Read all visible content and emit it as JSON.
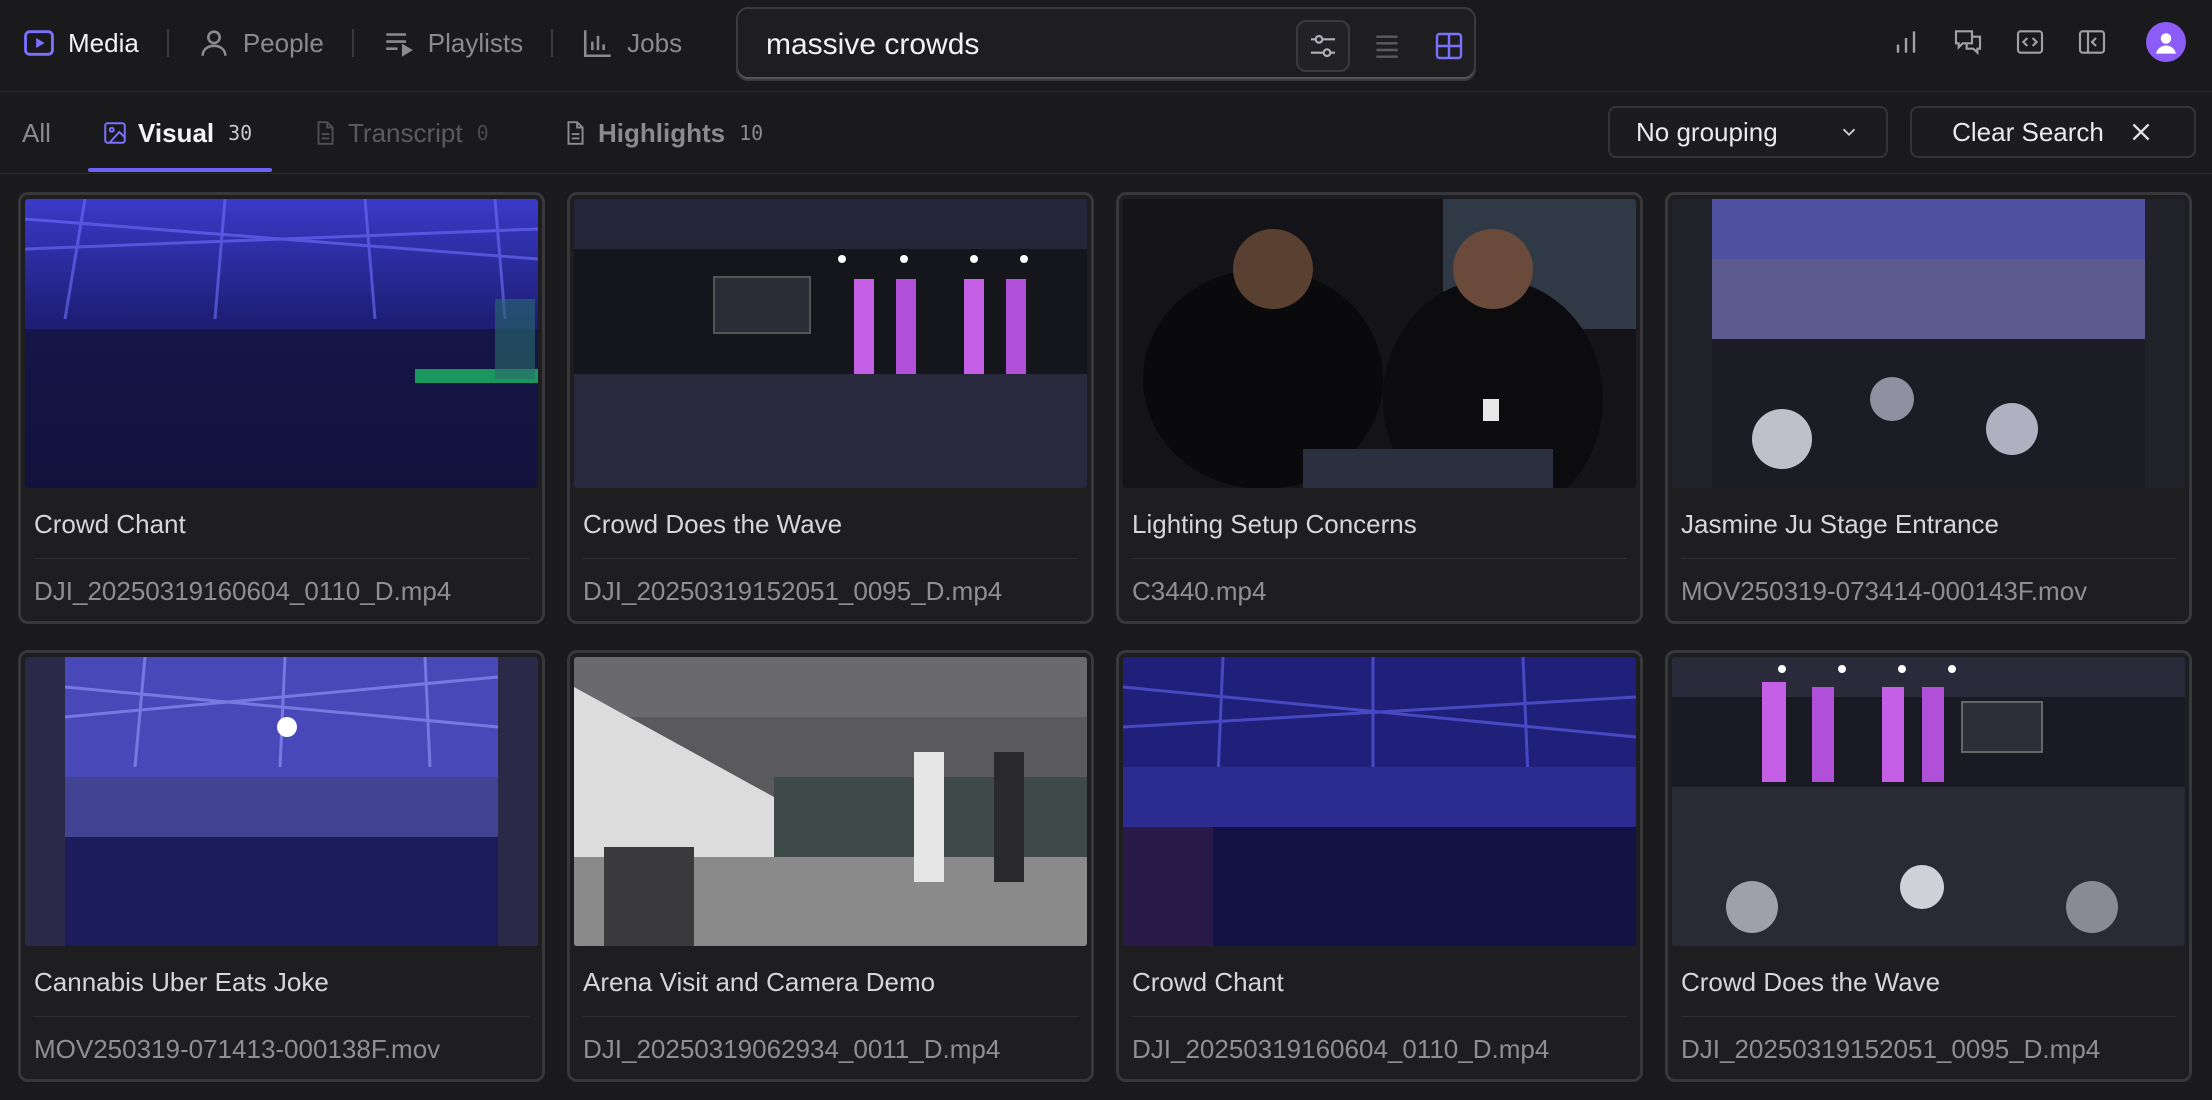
{
  "nav": {
    "items": [
      {
        "label": "Media",
        "icon": "play-icon",
        "active": true
      },
      {
        "label": "People",
        "icon": "person-icon",
        "active": false
      },
      {
        "label": "Playlists",
        "icon": "playlist-icon",
        "active": false
      },
      {
        "label": "Jobs",
        "icon": "bar-chart-icon",
        "active": false
      }
    ]
  },
  "search": {
    "value": "massive crowds",
    "view_modes": [
      "filter-sliders-icon",
      "list-view-icon",
      "grid-view-icon"
    ],
    "active_view": "grid"
  },
  "toolbar_icons": [
    "stats-icon",
    "chat-icon",
    "embed-code-icon",
    "panel-toggle-icon",
    "avatar"
  ],
  "tabs": [
    {
      "label": "All",
      "count": ""
    },
    {
      "label": "Visual",
      "count": "30",
      "active": true
    },
    {
      "label": "Transcript",
      "count": "0",
      "disabled": true
    },
    {
      "label": "Highlights",
      "count": "10"
    }
  ],
  "grouping": {
    "label": "No grouping"
  },
  "clear_search": {
    "label": "Clear Search"
  },
  "accent_color": "#6b63f6",
  "cards": [
    {
      "title": "Crowd Chant",
      "file": "DJI_20250319160604_0110_D.mp4"
    },
    {
      "title": "Crowd Does the Wave",
      "file": "DJI_20250319152051_0095_D.mp4"
    },
    {
      "title": "Lighting Setup Concerns",
      "file": "C3440.mp4"
    },
    {
      "title": "Jasmine Ju Stage Entrance",
      "file": "MOV250319-073414-000143F.mov"
    },
    {
      "title": "Cannabis Uber Eats Joke",
      "file": "MOV250319-071413-000138F.mov"
    },
    {
      "title": "Arena Visit and Camera Demo",
      "file": "DJI_20250319062934_0011_D.mp4"
    },
    {
      "title": "Crowd Chant",
      "file": "DJI_20250319160604_0110_D.mp4"
    },
    {
      "title": "Crowd Does the Wave",
      "file": "DJI_20250319152051_0095_D.mp4"
    }
  ]
}
